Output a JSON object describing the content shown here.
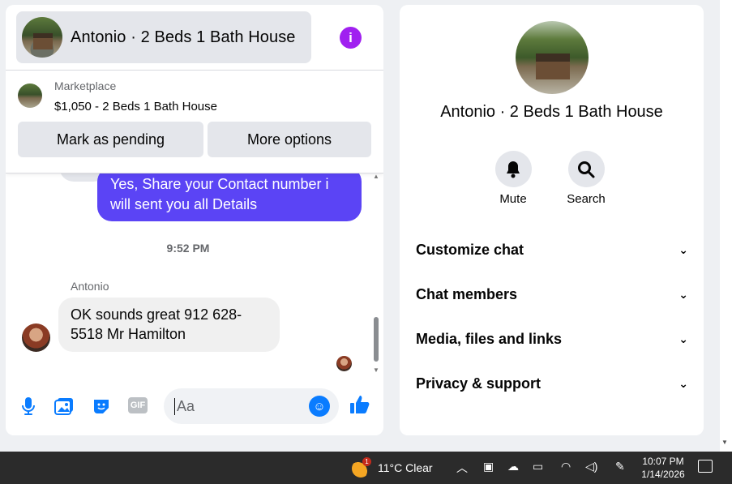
{
  "chat": {
    "title": "Antonio · 2 Beds 1 Bath House",
    "info_icon": "info-icon"
  },
  "marketplace": {
    "label": "Marketplace",
    "listing": "$1,050 - 2 Beds 1 Bath House",
    "pending_button": "Mark as pending",
    "more_button": "More options"
  },
  "messages": {
    "outgoing": "Yes, Share your Contact number i will sent you all Details",
    "timestamp": "9:52 PM",
    "sender": "Antonio",
    "incoming": "OK sounds great 912 628-5518 Mr Hamilton"
  },
  "composer": {
    "placeholder": "Aa",
    "icons": [
      "microphone-icon",
      "image-icon",
      "sticker-icon",
      "gif-icon",
      "emoji-icon",
      "like-icon"
    ],
    "gif_label": "GIF"
  },
  "info_panel": {
    "title": "Antonio · 2 Beds 1 Bath House",
    "actions": [
      {
        "label": "Mute",
        "icon": "bell-icon"
      },
      {
        "label": "Search",
        "icon": "search-icon"
      }
    ],
    "sections": [
      {
        "label": "Customize chat"
      },
      {
        "label": "Chat members"
      },
      {
        "label": "Media, files and links"
      },
      {
        "label": "Privacy & support"
      }
    ]
  },
  "taskbar": {
    "weather_badge": "1",
    "weather": "11°C  Clear",
    "time": "10:07 PM",
    "date": "1/14/2026"
  },
  "colors": {
    "accent": "#0a7cff",
    "outgoing_bubble": "#5b44f5",
    "info_icon": "#a020f0"
  }
}
